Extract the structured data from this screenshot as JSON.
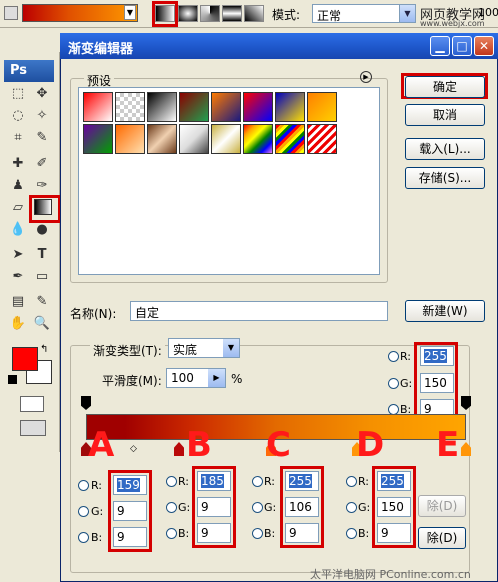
{
  "dialog": {
    "title": "渐变编辑器",
    "presets_label": "预设",
    "name_label": "名称(N):",
    "name_value": "自定",
    "type_label": "渐变类型(T):",
    "type_value": "实底",
    "smooth_label": "平滑度(M):",
    "smooth_value": "100",
    "smooth_unit": "%"
  },
  "buttons": {
    "ok": "确定",
    "cancel": "取消",
    "load": "载入(L)...",
    "save": "存储(S)...",
    "new": "新建(W)",
    "delete_top": "除(D)",
    "delete_bottom": "除(D)"
  },
  "optbar": {
    "mode_label": "模式:",
    "mode_value": "正常",
    "watermark": "网页教学网",
    "watermark_sub": "www.webjx.com",
    "right_value": "100"
  },
  "toolbox": {
    "logo": "Ps"
  },
  "color_right": {
    "r_label": "R:",
    "g_label": "G:",
    "b_label": "B:",
    "r": "255",
    "g": "150",
    "b": "9"
  },
  "stops": [
    {
      "letter": "A",
      "r": "159",
      "g": "9",
      "b": "9",
      "r_label": "R:",
      "g_label": "G:",
      "b_label": "B:"
    },
    {
      "letter": "B",
      "r": "185",
      "g": "9",
      "b": "9",
      "r_label": "R:",
      "g_label": "G:",
      "b_label": "B:"
    },
    {
      "letter": "C",
      "r": "255",
      "g": "106",
      "b": "9",
      "r_label": "R:",
      "g_label": "G:",
      "b_label": "B:"
    },
    {
      "letter": "D",
      "r": "255",
      "g": "150",
      "b": "9",
      "r_label": "R:",
      "g_label": "G:",
      "b_label": "B:"
    }
  ],
  "stop_e_letter": "E",
  "footer": "太平洋电脑网 PConline.com.cn",
  "colors": {
    "accent": "#d40000",
    "title_blue": "#1d55c8",
    "fg_color": "#ff0000"
  }
}
